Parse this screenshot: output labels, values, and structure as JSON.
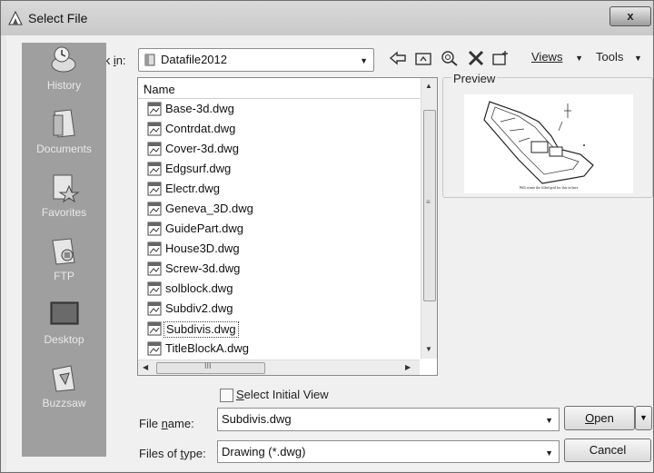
{
  "window": {
    "title": "Select File",
    "close_glyph": "x"
  },
  "look_in": {
    "label_pre": "Look ",
    "label_u": "i",
    "label_post": "n:",
    "value": "Datafile2012"
  },
  "toolbar": {
    "views": "Views",
    "tools": "Tools"
  },
  "places": {
    "items": [
      {
        "label": "History",
        "icon": "history-icon"
      },
      {
        "label": "Documents",
        "icon": "documents-icon"
      },
      {
        "label": "Favorites",
        "icon": "favorites-icon"
      },
      {
        "label": "FTP",
        "icon": "ftp-icon"
      },
      {
        "label": "Desktop",
        "icon": "desktop-icon"
      },
      {
        "label": "Buzzsaw",
        "icon": "buzzsaw-icon"
      }
    ]
  },
  "file_list": {
    "column_header": "Name",
    "files": [
      "Base-3d.dwg",
      "Contrdat.dwg",
      "Cover-3d.dwg",
      "Edgsurf.dwg",
      "Electr.dwg",
      "Geneva_3D.dwg",
      "GuidePart.dwg",
      "House3D.dwg",
      "Screw-3d.dwg",
      "solblock.dwg",
      "Subdiv2.dwg",
      "Subdivis.dwg",
      "TitleBlockA.dwg"
    ],
    "selected": "Subdivis.dwg"
  },
  "preview": {
    "label": "Preview",
    "caption": "Will create the filled grid for this in here"
  },
  "select_initial_view": {
    "label_u": "S",
    "label_rest": "elect Initial View",
    "checked": false
  },
  "file_name": {
    "label_pre": "File ",
    "label_u": "n",
    "label_post": "ame:",
    "value": "Subdivis.dwg"
  },
  "file_type": {
    "label_pre": "Files of ",
    "label_u": "t",
    "label_post": "ype:",
    "value": "Drawing (*.dwg)"
  },
  "buttons": {
    "open_u": "O",
    "open_rest": "pen",
    "cancel": "Cancel"
  }
}
